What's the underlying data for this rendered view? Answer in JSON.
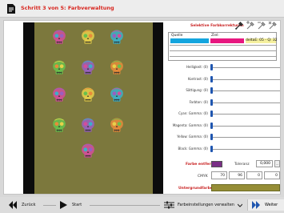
{
  "window": {
    "title": "Schritt 3 von 5: Farbverwaltung",
    "accent_color": "#d8261f"
  },
  "preview": {
    "background_color": "#7c783d",
    "skull_colors": [
      "#d44d9a",
      "#e7d04a",
      "#3bb0c9",
      "#67c14e",
      "#9a5fc0",
      "#e98b3a"
    ]
  },
  "selective": {
    "label": "Selektive Farbkorrekturen",
    "picker_icons": [
      "eyedropper-icon",
      "eyedropper-plus-icon",
      "eyedropper-minus-icon",
      "eyedropper-reset-icon"
    ]
  },
  "source_target": {
    "source_label": "Quelle",
    "target_label": "Ziel:",
    "source_color": "#14a5de",
    "target_color": "#e7177f",
    "delta_text": "deltaE: 05 - Q: 32"
  },
  "sliders": [
    {
      "label": "Helligkeit: (0)"
    },
    {
      "label": "Kontrast: (0)"
    },
    {
      "label": "Sättigung: (0)"
    },
    {
      "label": "Farbton: (0)"
    },
    {
      "label": "Cyan: Gamma: (0)"
    },
    {
      "label": "Magenta: Gamma: (0)"
    },
    {
      "label": "Yellow: Gamma: (0)"
    },
    {
      "label": "Black: Gamma: (0)"
    }
  ],
  "remove_color": {
    "label": "Farbe entfernen",
    "swatch_color": "#7a2f86",
    "tolerance_label": "Toleranz",
    "tolerance_value": "0,000",
    "tolerance_button": "..."
  },
  "cmyk": {
    "label": "CMYK",
    "values": [
      "70",
      "96",
      "0",
      "0"
    ]
  },
  "background_color": {
    "label": "Untergrundfarbe",
    "swatch_color": "#958d36"
  },
  "bottom": {
    "back_label": "Zurück",
    "start_label": "Start",
    "settings_label": "Farbeinstellungen verwalten",
    "next_label": "Weiter"
  }
}
